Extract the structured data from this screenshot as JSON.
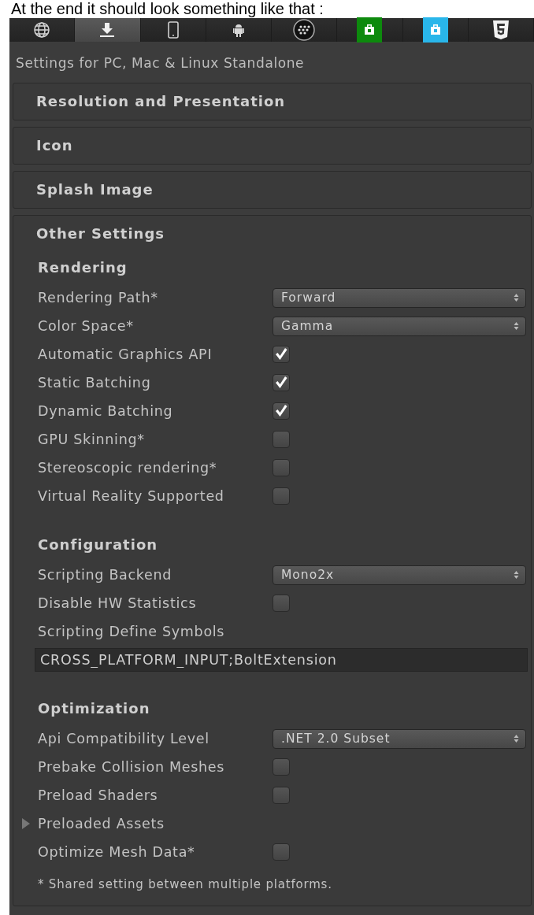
{
  "caption": "At the end it should look something like that :",
  "platform_tabs": [
    {
      "kind": "globe",
      "selected": false
    },
    {
      "kind": "download",
      "selected": true
    },
    {
      "kind": "phone",
      "selected": false
    },
    {
      "kind": "robot",
      "selected": false
    },
    {
      "kind": "dots",
      "selected": false
    },
    {
      "kind": "green-bag",
      "selected": false
    },
    {
      "kind": "blue-bag",
      "selected": false
    },
    {
      "kind": "shield",
      "selected": false
    }
  ],
  "title": "Settings for PC, Mac & Linux Standalone",
  "sections": [
    {
      "title": "Resolution and Presentation"
    },
    {
      "title": "Icon"
    },
    {
      "title": "Splash Image"
    },
    {
      "title": "Other Settings",
      "groups": [
        {
          "heading": "Rendering",
          "rows": [
            {
              "kind": "dropdown",
              "label": "Rendering Path*",
              "value": "Forward"
            },
            {
              "kind": "dropdown",
              "label": "Color Space*",
              "value": "Gamma"
            },
            {
              "kind": "checkbox",
              "label": "Automatic Graphics API",
              "checked": true
            },
            {
              "kind": "checkbox",
              "label": "Static Batching",
              "checked": true
            },
            {
              "kind": "checkbox",
              "label": "Dynamic Batching",
              "checked": true
            },
            {
              "kind": "checkbox",
              "label": "GPU Skinning*",
              "checked": false
            },
            {
              "kind": "checkbox",
              "label": "Stereoscopic rendering*",
              "checked": false
            },
            {
              "kind": "checkbox",
              "label": "Virtual Reality Supported",
              "checked": false
            }
          ]
        },
        {
          "heading": "Configuration",
          "rows": [
            {
              "kind": "dropdown",
              "label": "Scripting Backend",
              "value": "Mono2x"
            },
            {
              "kind": "checkbox",
              "label": "Disable HW Statistics",
              "checked": false
            },
            {
              "kind": "label",
              "label": "Scripting Define Symbols"
            },
            {
              "kind": "text",
              "value": "CROSS_PLATFORM_INPUT;BoltExtension"
            }
          ]
        },
        {
          "heading": "Optimization",
          "rows": [
            {
              "kind": "dropdown",
              "label": "Api Compatibility Level",
              "value": ".NET 2.0 Subset"
            },
            {
              "kind": "checkbox",
              "label": "Prebake Collision Meshes",
              "checked": false
            },
            {
              "kind": "checkbox",
              "label": "Preload Shaders",
              "checked": false
            },
            {
              "kind": "foldout",
              "label": "Preloaded Assets",
              "expanded": false
            },
            {
              "kind": "checkbox",
              "label": "Optimize Mesh Data*",
              "checked": false
            }
          ]
        }
      ],
      "footnote": "* Shared setting between multiple platforms."
    }
  ]
}
